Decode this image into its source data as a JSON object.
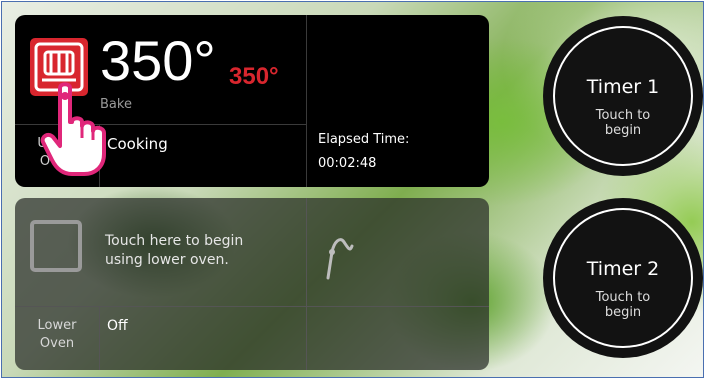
{
  "upper_oven": {
    "temperature": "350°",
    "set_temperature": "350°",
    "mode": "Bake",
    "label_line1": "Upper",
    "label_line2": "Oven",
    "status": "Cooking",
    "elapsed_label": "Elapsed Time:",
    "elapsed_value": "00:02:48"
  },
  "lower_oven": {
    "prompt_line1": "Touch here to begin",
    "prompt_line2": "using lower oven.",
    "label_line1": "Lower",
    "label_line2": "Oven",
    "status": "Off"
  },
  "timers": [
    {
      "title": "Timer 1",
      "hint_line1": "Touch to",
      "hint_line2": "begin"
    },
    {
      "title": "Timer 2",
      "hint_line1": "Touch to",
      "hint_line2": "begin"
    }
  ],
  "colors": {
    "accent_red": "#d8262e",
    "panel_black": "#000000",
    "touch_hand": "#e0277a"
  },
  "icons": {
    "upper_mode": "bake-element-icon",
    "lower_mode": "empty-square-icon",
    "lower_probe": "probe-icon",
    "hand": "touch-hand-icon"
  }
}
